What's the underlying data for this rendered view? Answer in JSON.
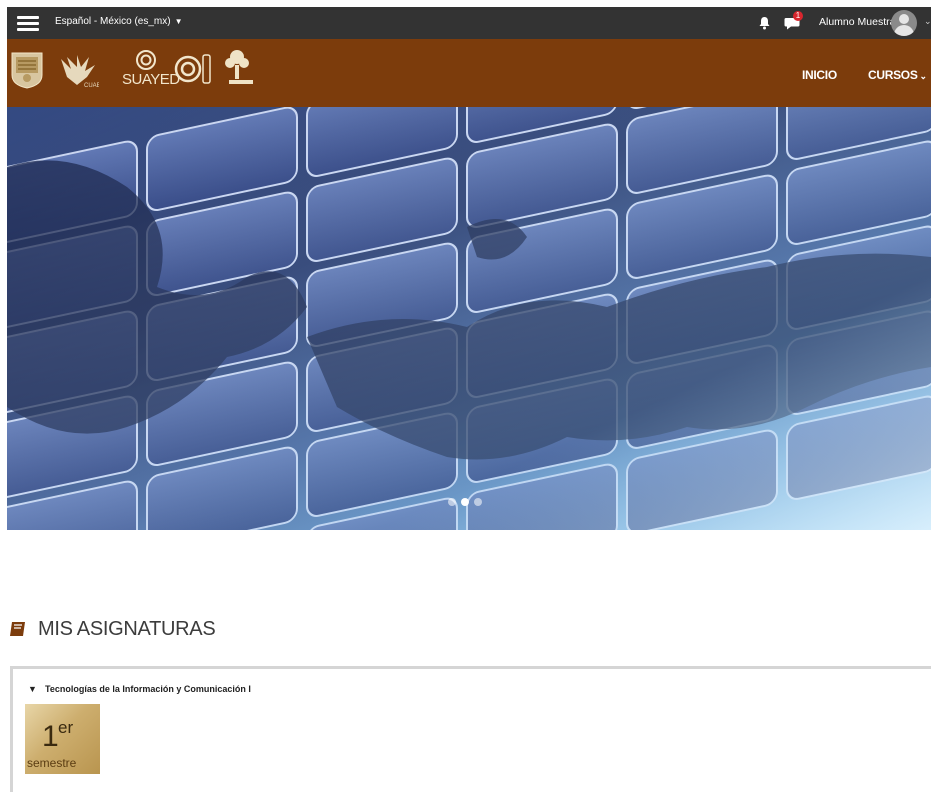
{
  "topbar": {
    "language": "Español - México (es_mx)",
    "notification_count": "1",
    "user_name": "Alumno Muestra"
  },
  "nav": {
    "logos": [
      "unam-seal-logo",
      "cuaed-eagle-logo",
      "suayed-logo",
      "cuaed-logo",
      "dgdc-tree-logo"
    ],
    "suayed_label": "SUAYED",
    "links": [
      "INICIO",
      "CURSOS"
    ]
  },
  "hero": {
    "alt_topic": "world map over financial ticker numbers",
    "slides": 3,
    "active_slide": 2
  },
  "section": {
    "title": "MIS ASIGNATURAS"
  },
  "course": {
    "name": "Tecnologías de la Información y Comunicación I",
    "thumb_number": "1",
    "thumb_sup": "er",
    "thumb_word": "semestre"
  },
  "colors": {
    "topbar": "#333333",
    "navbar": "#7c3c0c",
    "badge": "#d9262e"
  }
}
